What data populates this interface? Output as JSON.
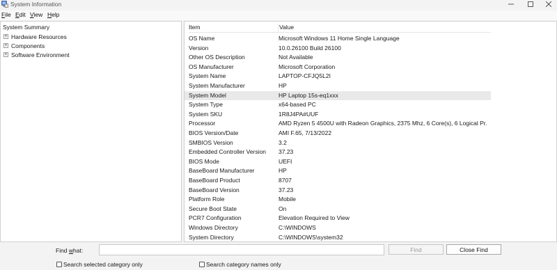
{
  "window": {
    "title": "System Information",
    "icons": {
      "app": "system-information-icon",
      "minimize": "minimize-icon",
      "maximize": "maximize-icon",
      "close": "close-icon"
    }
  },
  "menu": [
    {
      "label": "File",
      "accelerator": "F",
      "rest": "ile"
    },
    {
      "label": "Edit",
      "accelerator": "E",
      "rest": "dit"
    },
    {
      "label": "View",
      "accelerator": "V",
      "rest": "iew"
    },
    {
      "label": "Help",
      "accelerator": "H",
      "rest": "elp"
    }
  ],
  "tree": {
    "root": "System Summary",
    "items": [
      {
        "label": "Hardware Resources",
        "expander": "+"
      },
      {
        "label": "Components",
        "expander": "+"
      },
      {
        "label": "Software Environment",
        "expander": "+"
      }
    ]
  },
  "detail": {
    "columns": {
      "item": "Item",
      "value": "Value"
    },
    "selected_row": 6,
    "rows": [
      {
        "item": "OS Name",
        "value": "Microsoft Windows 11 Home Single Language"
      },
      {
        "item": "Version",
        "value": "10.0.26100 Build 26100"
      },
      {
        "item": "Other OS Description",
        "value": "Not Available"
      },
      {
        "item": "OS Manufacturer",
        "value": "Microsoft Corporation"
      },
      {
        "item": "System Name",
        "value": "LAPTOP-CFJQ5L2I"
      },
      {
        "item": "System Manufacturer",
        "value": "HP"
      },
      {
        "item": "System Model",
        "value": "HP Laptop 15s-eq1xxx"
      },
      {
        "item": "System Type",
        "value": "x64-based PC"
      },
      {
        "item": "System SKU",
        "value": "1R8J4PA#UUF"
      },
      {
        "item": "Processor",
        "value": "AMD Ryzen 5 4500U with Radeon Graphics, 2375 Mhz, 6 Core(s), 6 Logical Pr..."
      },
      {
        "item": "BIOS Version/Date",
        "value": "AMI F.65, 7/13/2022"
      },
      {
        "item": "SMBIOS Version",
        "value": "3.2"
      },
      {
        "item": "Embedded Controller Version",
        "value": "37.23"
      },
      {
        "item": "BIOS Mode",
        "value": "UEFI"
      },
      {
        "item": "BaseBoard Manufacturer",
        "value": "HP"
      },
      {
        "item": "BaseBoard Product",
        "value": "8707"
      },
      {
        "item": "BaseBoard Version",
        "value": "37.23"
      },
      {
        "item": "Platform Role",
        "value": "Mobile"
      },
      {
        "item": "Secure Boot State",
        "value": "On"
      },
      {
        "item": "PCR7 Configuration",
        "value": "Elevation Required to View"
      },
      {
        "item": "Windows Directory",
        "value": "C:\\WINDOWS"
      },
      {
        "item": "System Directory",
        "value": "C:\\WINDOWS\\system32"
      }
    ]
  },
  "find": {
    "label": "Find what:",
    "label_accelerator": "w",
    "input_value": "",
    "find_button": "Find",
    "close_find_button": "Close Find",
    "search_selected_label": "Search selected category only",
    "search_names_label": "Search category names only"
  }
}
